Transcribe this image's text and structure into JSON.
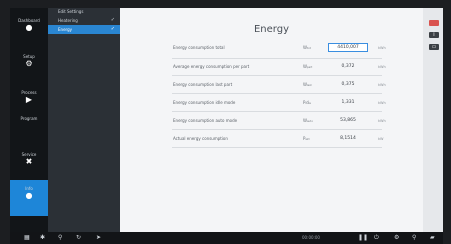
{
  "sidebar": {
    "items": [
      {
        "label": "Dashboard",
        "icon": "dashboard-icon"
      },
      {
        "label": "Setup",
        "icon": "setup-icon"
      },
      {
        "label": "Process",
        "icon": "play-icon"
      },
      {
        "label": "Program",
        "icon": "program-icon"
      },
      {
        "label": "Service",
        "icon": "service-icon"
      },
      {
        "label": "Info",
        "icon": "info-icon"
      }
    ]
  },
  "submenu": {
    "header": "Edit Settings",
    "items": [
      {
        "label": "Heatering"
      },
      {
        "label": "Energy"
      }
    ]
  },
  "energy": {
    "title": "Energy",
    "rows": [
      {
        "label": "Energy consumption total",
        "symbol": "Wₜₒₜ",
        "value": "4410,007",
        "unit": "kWh"
      },
      {
        "label": "Average energy consumption per part",
        "symbol": "Wₚₐᵣₜ",
        "value": "0,372",
        "unit": "kWh"
      },
      {
        "label": "Energy consumption last part",
        "symbol": "Wₗₐₛₜ",
        "value": "0,375",
        "unit": "kWh"
      },
      {
        "label": "Energy consumption idle mode",
        "symbol": "Pᵢdₗₑ",
        "value": "1,331",
        "unit": "kWh"
      },
      {
        "label": "Energy consumption auto mode",
        "symbol": "Wₐᵤₜₒ",
        "value": "53,865",
        "unit": "kWh"
      },
      {
        "label": "Actual energy consumption",
        "symbol": "Pₐₖₜ",
        "value": "8,1514",
        "unit": "kW"
      }
    ]
  },
  "statusbar": {
    "time": "00:00:00"
  },
  "colors": {
    "accent": "#1e86d8",
    "nav_bg": "#121518",
    "content_bg": "#f4f5f7"
  }
}
